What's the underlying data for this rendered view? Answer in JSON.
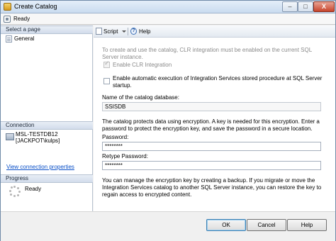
{
  "window": {
    "title": "Create Catalog",
    "close_glyph": "X"
  },
  "status": {
    "text": "Ready"
  },
  "left": {
    "select_page_header": "Select a page",
    "pages": [
      {
        "label": "General"
      }
    ],
    "connection_header": "Connection",
    "connection_server": "MSL-TESTDB12",
    "connection_user": "[JACKPOT\\kulps]",
    "view_link": "View connection properties",
    "progress_header": "Progress",
    "progress_status": "Ready"
  },
  "toolbar": {
    "script_label": "Script",
    "help_label": "Help",
    "help_glyph": "?"
  },
  "form": {
    "clr_note": "To create and use the catalog, CLR integration must be enabled on the current SQL Server instance.",
    "enable_clr_label": "Enable CLR Integration",
    "enable_clr_checked": true,
    "auto_exec_label": "Enable automatic execution of Integration Services stored procedure at SQL Server startup.",
    "auto_exec_checked": false,
    "catalog_name_label": "Name of the catalog database:",
    "catalog_name_value": "SSISDB",
    "encryption_note": "The catalog protects data using encryption. A key is needed for this encryption. Enter a password to protect the encryption key, and save the password in a secure location.",
    "password_label": "Password:",
    "password_value": "********",
    "retype_label": "Retype Password:",
    "retype_value": "********",
    "backup_note": "You can manage the encryption key by creating a backup. If you migrate or move the Integration Services catalog to another SQL Server instance, you can restore the key to regain access to encrypted content."
  },
  "buttons": {
    "ok": "OK",
    "cancel": "Cancel",
    "help": "Help"
  }
}
